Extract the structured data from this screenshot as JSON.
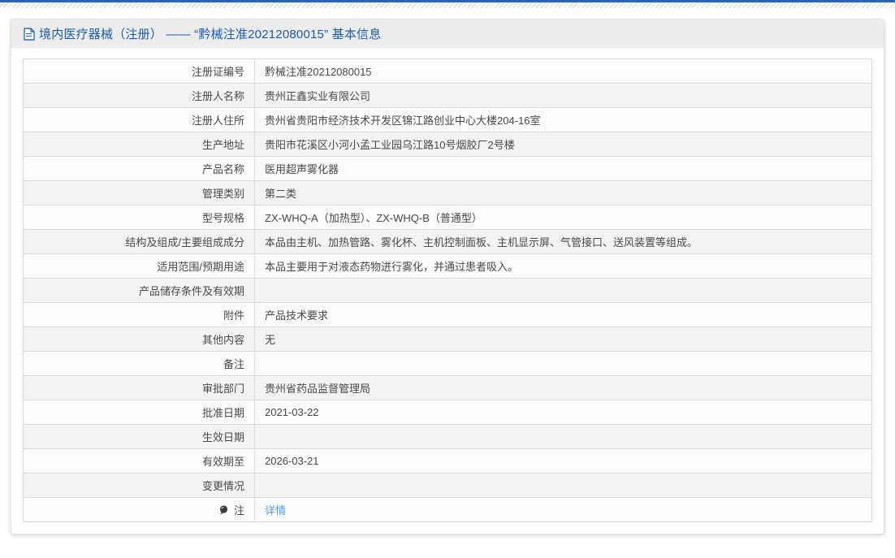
{
  "page": {
    "accent_color": "#2668b0",
    "title_color": "#1b5cab",
    "link_color": "#55a1ec",
    "header": {
      "icon": "document-icon",
      "title": "境内医疗器械（注册） —— “黔械注准20212080015” 基本信息"
    }
  },
  "table": {
    "rows": [
      {
        "label": "注册证编号",
        "value": "黔械注准20212080015"
      },
      {
        "label": "注册人名称",
        "value": "贵州正鑫实业有限公司"
      },
      {
        "label": "注册人住所",
        "value": "贵州省贵阳市经济技术开发区锦江路创业中心大楼204-16室"
      },
      {
        "label": "生产地址",
        "value": "贵阳市花溪区小河小孟工业园乌江路10号烟胶厂2号楼"
      },
      {
        "label": "产品名称",
        "value": "医用超声雾化器"
      },
      {
        "label": "管理类别",
        "value": "第二类"
      },
      {
        "label": "型号规格",
        "value": "ZX-WHQ-A（加热型）、ZX-WHQ-B（普通型）"
      },
      {
        "label": "结构及组成/主要组成成分",
        "value": "本品由主机、加热管路、雾化杯、主机控制面板、主机显示屏、气管接口、送风装置等组成。"
      },
      {
        "label": "适用范围/预期用途",
        "value": "本品主要用于对液态药物进行雾化，并通过患者吸入。"
      },
      {
        "label": "产品储存条件及有效期",
        "value": ""
      },
      {
        "label": "附件",
        "value": "产品技术要求"
      },
      {
        "label": "其他内容",
        "value": "无"
      },
      {
        "label": "备注",
        "value": ""
      },
      {
        "label": "审批部门",
        "value": "贵州省药品监督管理局"
      },
      {
        "label": "批准日期",
        "value": "2021-03-22"
      },
      {
        "label": "生效日期",
        "value": ""
      },
      {
        "label": "有效期至",
        "value": "2026-03-21"
      },
      {
        "label": "变更情况",
        "value": ""
      },
      {
        "label": "注",
        "value": "详情",
        "is_link": true,
        "label_icon": "note-icon"
      }
    ]
  }
}
